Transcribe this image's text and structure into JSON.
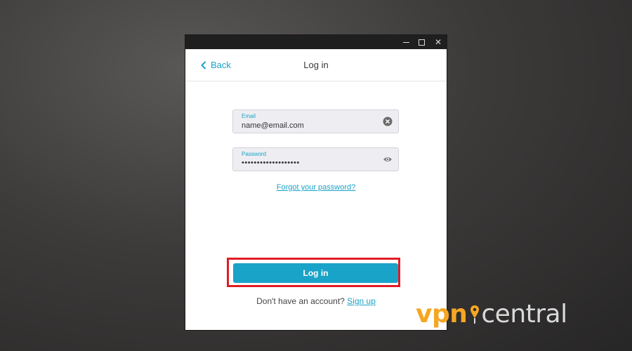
{
  "header": {
    "back_label": "Back",
    "title": "Log in"
  },
  "email": {
    "label": "Email",
    "value": "name@email.com"
  },
  "password": {
    "label": "Password",
    "value": "•••••••••••••••••••"
  },
  "forgot_password": "Forgot your password?",
  "login_button": "Log in",
  "signup": {
    "prompt": "Don't have an account?",
    "link": "Sign up"
  },
  "watermark": {
    "part1": "vpn",
    "part2": "central"
  },
  "colors": {
    "accent": "#1aa3c8",
    "highlight": "#e01c24",
    "brand_orange": "#f5a623"
  },
  "icons": {
    "window_controls": [
      "minimize-icon",
      "maximize-icon",
      "close-icon"
    ],
    "email_field": "clear-icon",
    "password_field": "eye-icon"
  }
}
